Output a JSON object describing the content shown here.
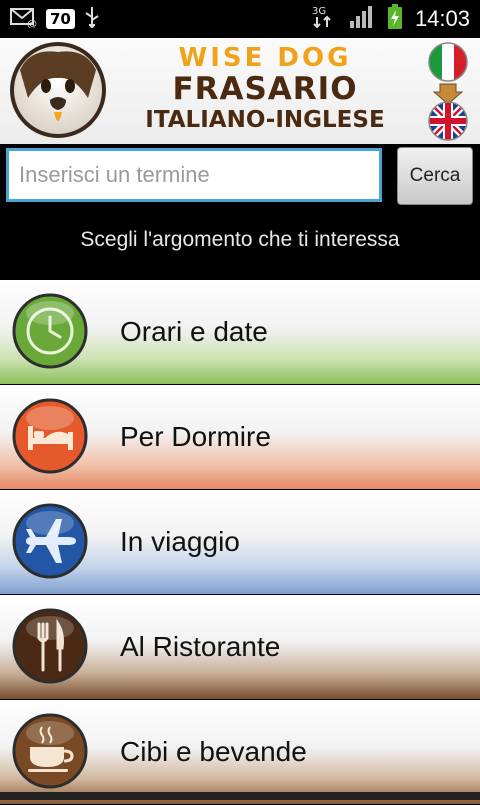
{
  "status_bar": {
    "battery_level_badge": "70",
    "clock": "14:03",
    "network": "3G"
  },
  "header": {
    "brand_line1": "WISE DOG",
    "brand_line2": "FRASARIO",
    "brand_line3": "ITALIANO-INGLESE"
  },
  "search": {
    "placeholder": "Inserisci un termine",
    "value": "",
    "button_label": "Cerca"
  },
  "subtitle": "Scegli l'argomento che ti interessa",
  "categories": [
    {
      "label": "Orari e date",
      "icon": "clock-icon",
      "color": "#7fb84a"
    },
    {
      "label": "Per Dormire",
      "icon": "bed-icon",
      "color": "#e5592a"
    },
    {
      "label": "In viaggio",
      "icon": "airplane-icon",
      "color": "#2456a6"
    },
    {
      "label": "Al Ristorante",
      "icon": "fork-knife-icon",
      "color": "#4a2a15"
    },
    {
      "label": "Cibi e bevande",
      "icon": "coffee-cup-icon",
      "color": "#7a4a26"
    }
  ]
}
